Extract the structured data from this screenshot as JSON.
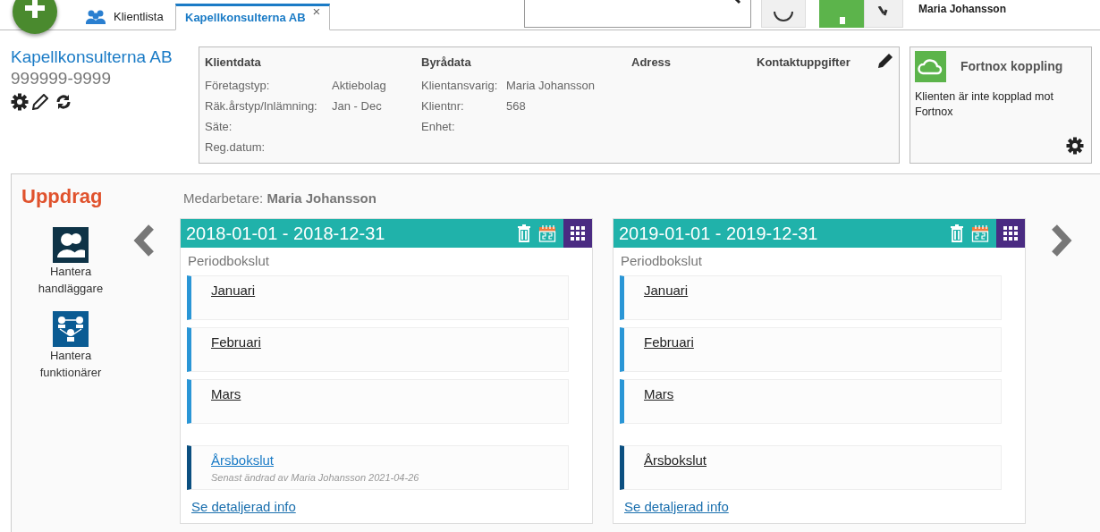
{
  "header": {
    "tabs": [
      {
        "label": "Klientlista",
        "selected": false
      },
      {
        "label": "Kapellkonsulterna AB",
        "selected": true,
        "close": "×"
      }
    ],
    "user": "Maria Johansson"
  },
  "client": {
    "name": "Kapellkonsulterna AB",
    "orgnr": "999999-9999"
  },
  "client_data": {
    "sections": [
      {
        "title": "Klientdata",
        "rows": [
          {
            "label": "Företagstyp:",
            "value": "Aktiebolag"
          },
          {
            "label": "Räk.årstyp/Inlämning:",
            "value": "Jan - Dec"
          },
          {
            "label": "Säte:"
          },
          {
            "label": "Reg.datum:"
          }
        ]
      },
      {
        "title": "Byrådata",
        "rows": [
          {
            "label": "Klientansvarig:",
            "value": "Maria Johansson"
          },
          {
            "label": "Klientnr:",
            "value": "568"
          },
          {
            "label": "Enhet:"
          }
        ]
      },
      {
        "title": "Adress"
      },
      {
        "title": "Kontaktuppgifter"
      }
    ]
  },
  "fortnox": {
    "title": "Fortnox koppling",
    "text": "Klienten är inte kopplad mot Fortnox"
  },
  "assignments": {
    "title": "Uppdrag",
    "staff": "Medarbetare: **Maria Johansson**",
    "actions": [
      {
        "label": "Hantera handläggare",
        "kind": "handlers"
      },
      {
        "label": "Hantera funktionärer",
        "kind": "officials"
      }
    ],
    "periods": [
      {
        "title": "2018-01-01 - 2018-12-31",
        "section": "Periodbokslut",
        "months": [
          "Januari",
          "Februari",
          "Mars"
        ],
        "year_end": {
          "label": "Årsbokslut",
          "edited": true,
          "note": "Senast ändrad av Maria Johansson 2021-04-26"
        },
        "details_link": "Se detaljerad info"
      },
      {
        "title": "2019-01-01 - 2019-12-31",
        "section": "Periodbokslut",
        "months": [
          "Januari",
          "Februari",
          "Mars"
        ],
        "year_end": {
          "label": "Årsbokslut",
          "edited": false
        },
        "details_link": "Se detaljerad info"
      }
    ]
  }
}
